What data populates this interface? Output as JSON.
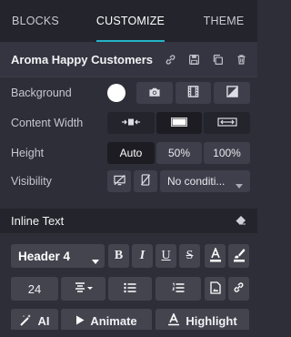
{
  "tabs": [
    "BLOCKS",
    "CUSTOMIZE",
    "THEME"
  ],
  "active_tab": "CUSTOMIZE",
  "block": {
    "title": "Aroma Happy Customers",
    "header_icons": [
      "link-icon",
      "save-icon",
      "duplicate-icon",
      "trash-icon"
    ]
  },
  "rows": {
    "background": {
      "label": "Background",
      "color": "#ffffff",
      "icons": [
        "camera-icon",
        "film-icon",
        "gradient-icon"
      ]
    },
    "content_width": {
      "label": "Content Width",
      "icons": [
        "narrow-width-icon",
        "medium-width-icon",
        "full-width-icon"
      ],
      "selected": 1
    },
    "height": {
      "label": "Height",
      "options": [
        "Auto",
        "50%",
        "100%"
      ],
      "selected": "Auto"
    },
    "visibility": {
      "label": "Visibility",
      "icons": [
        "hide-desktop-icon",
        "hide-mobile-icon"
      ],
      "select_value": "No conditi..."
    }
  },
  "inline_text": {
    "title": "Inline Text",
    "heading_select": "Header 4",
    "format_buttons": [
      "B",
      "I",
      "U",
      "S"
    ],
    "font_size": "24",
    "ai_label": "AI",
    "animate_label": "Animate",
    "highlight_label": "Highlight"
  },
  "colors": {
    "accent": "#24b3c7",
    "panel": "#2e2e38",
    "button": "#3f3f4b"
  }
}
